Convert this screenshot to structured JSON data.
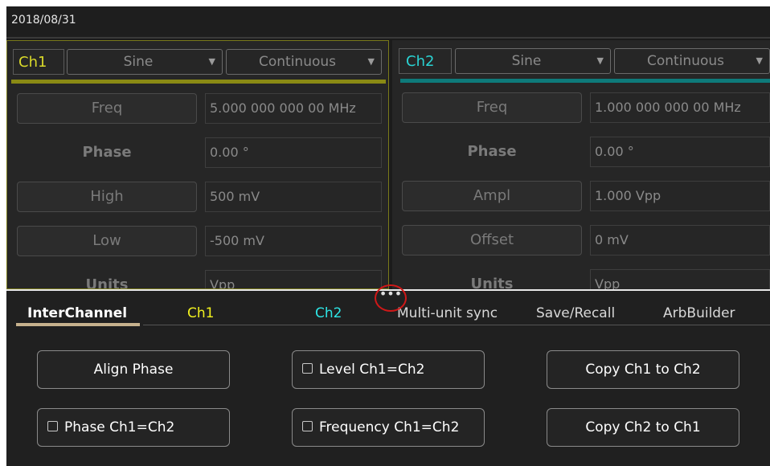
{
  "header": {
    "date": "2018/08/31"
  },
  "ch1": {
    "label": "Ch1",
    "waveform": "Sine",
    "mode": "Continuous",
    "params": [
      {
        "name": "Freq",
        "value": "5.000 000 000 00 MHz",
        "button": true
      },
      {
        "name": "Phase",
        "value": "0.00 °",
        "button": false
      },
      {
        "name": "High",
        "value": "500 mV",
        "button": true
      },
      {
        "name": "Low",
        "value": "-500 mV",
        "button": true
      },
      {
        "name": "Units",
        "value": "Vpp",
        "button": false
      }
    ]
  },
  "ch2": {
    "label": "Ch2",
    "waveform": "Sine",
    "mode": "Continuous",
    "params": [
      {
        "name": "Freq",
        "value": "1.000 000 000 00 MHz",
        "button": true
      },
      {
        "name": "Phase",
        "value": "0.00 °",
        "button": false
      },
      {
        "name": "Ampl",
        "value": "1.000 Vpp",
        "button": true
      },
      {
        "name": "Offset",
        "value": "0 mV",
        "button": true
      },
      {
        "name": "Units",
        "value": "Vpp",
        "button": false
      }
    ]
  },
  "drawer": {
    "handle": "•••",
    "tabs": [
      {
        "label": "InterChannel",
        "color": "#ffffff",
        "active": true
      },
      {
        "label": "Ch1",
        "color": "#f2f21e"
      },
      {
        "label": "Ch2",
        "color": "#2de6e6"
      },
      {
        "label": "Multi-unit sync",
        "color": "#d8d8d8"
      },
      {
        "label": "Save/Recall",
        "color": "#d8d8d8"
      },
      {
        "label": "ArbBuilder",
        "color": "#d8d8d8"
      }
    ],
    "buttons": {
      "align_phase": "Align Phase",
      "level": "Level Ch1=Ch2",
      "copy_1_2": "Copy Ch1 to Ch2",
      "phase": "Phase Ch1=Ch2",
      "frequency": "Frequency Ch1=Ch2",
      "copy_2_1": "Copy Ch2 to Ch1"
    }
  }
}
